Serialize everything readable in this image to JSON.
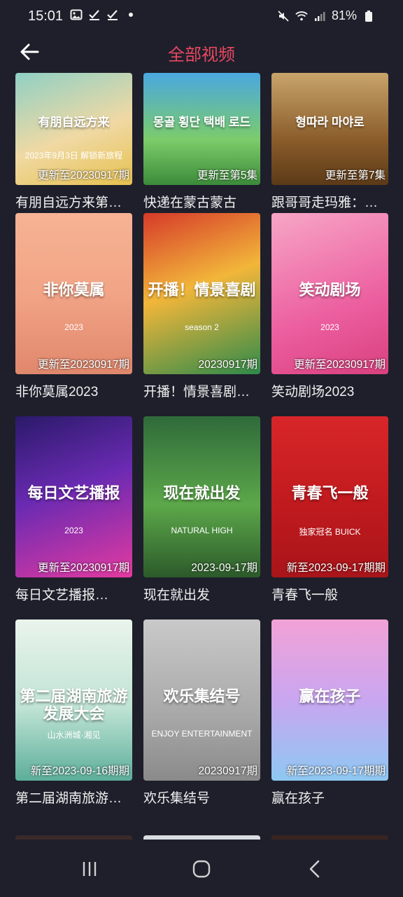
{
  "status_bar": {
    "time": "15:01",
    "left_icons": [
      "image-icon",
      "check-icon",
      "check-icon",
      "dot-icon"
    ],
    "battery": "81%"
  },
  "header": {
    "title": "全部视频",
    "title_color": "#e8485f"
  },
  "videos": [
    {
      "caption": "有朋自远方来第…",
      "badge": "更新至20230917期",
      "thumb_text": "有朋自远方来",
      "thumb_sub": "2023年9月3日 解锁新旅程",
      "bg": "linear-gradient(160deg,#8fd0c4,#f0d9a4 55%,#e6c14f)"
    },
    {
      "caption": "快递在蒙古蒙古",
      "badge": "更新至第5集",
      "thumb_text": "몽골 횡단 택배 로드",
      "thumb_sub": "",
      "bg": "linear-gradient(180deg,#4aa8e0,#7ccc6a 60%,#3c8a3a)"
    },
    {
      "caption": "跟哥哥走玛雅：…",
      "badge": "更新至第7集",
      "thumb_text": "형따라 마야로",
      "thumb_sub": "",
      "bg": "linear-gradient(180deg,#c8a46a,#8a5c2a 60%,#5c3a18)"
    },
    {
      "caption": "非你莫属2023",
      "badge": "更新至20230917期",
      "thumb_text": "非你莫属",
      "thumb_sub": "2023",
      "bg": "linear-gradient(180deg,#f6b394,#f2a486 50%,#e0876c)"
    },
    {
      "caption": "开播！情景喜剧…",
      "badge": "20230917期",
      "thumb_text": "开播！情景喜剧",
      "thumb_sub": "season 2",
      "bg": "linear-gradient(160deg,#d63a2a,#f2b63a 45%,#2e8a4a)"
    },
    {
      "caption": "笑动剧场2023",
      "badge": "更新至20230917期",
      "thumb_text": "笑动剧场",
      "thumb_sub": "2023",
      "bg": "linear-gradient(160deg,#f7a6c6,#ec5fa0 60%,#d9407e)"
    },
    {
      "caption": "每日文艺播报…",
      "badge": "更新至20230917期",
      "thumb_text": "每日文艺播报",
      "thumb_sub": "2023",
      "bg": "linear-gradient(160deg,#2a1a6a,#6a2ab2 45%,#e43aa0)"
    },
    {
      "caption": "现在就出发",
      "badge": "2023-09-17期",
      "thumb_text": "现在就出发",
      "thumb_sub": "NATURAL HIGH",
      "bg": "linear-gradient(180deg,#2f6a3a,#5ca84a 55%,#2c5a2a)"
    },
    {
      "caption": "青春飞一般",
      "badge": "新至2023-09-17期期",
      "thumb_text": "青春飞一般",
      "thumb_sub": "独家冠名 BUICK",
      "bg": "linear-gradient(180deg,#d8262a,#c01a1e 55%,#a8151a)"
    },
    {
      "caption": "第二届湖南旅游…",
      "badge": "新至2023-09-16期期",
      "thumb_text": "第二届湖南旅游发展大会",
      "thumb_sub": "山水洲城·湘见",
      "bg": "linear-gradient(180deg,#eaf4ec,#bfe3d4 55%,#5cae9a)"
    },
    {
      "caption": "欢乐集结号",
      "badge": "20230917期",
      "thumb_text": "欢乐集结号",
      "thumb_sub": "ENJOY ENTERTAINMENT",
      "bg": "linear-gradient(180deg,#c9c9c9,#a8a8a8 60%,#8a8a8a)"
    },
    {
      "caption": "赢在孩子",
      "badge": "新至2023-09-17期期",
      "thumb_text": "赢在孩子",
      "thumb_sub": "",
      "bg": "linear-gradient(180deg,#f2a2d6,#c9a6f0 50%,#8ec8f2)"
    }
  ],
  "nav": {
    "recent_icon": "recent-apps-icon",
    "home_icon": "home-icon",
    "back_icon": "back-nav-icon"
  }
}
